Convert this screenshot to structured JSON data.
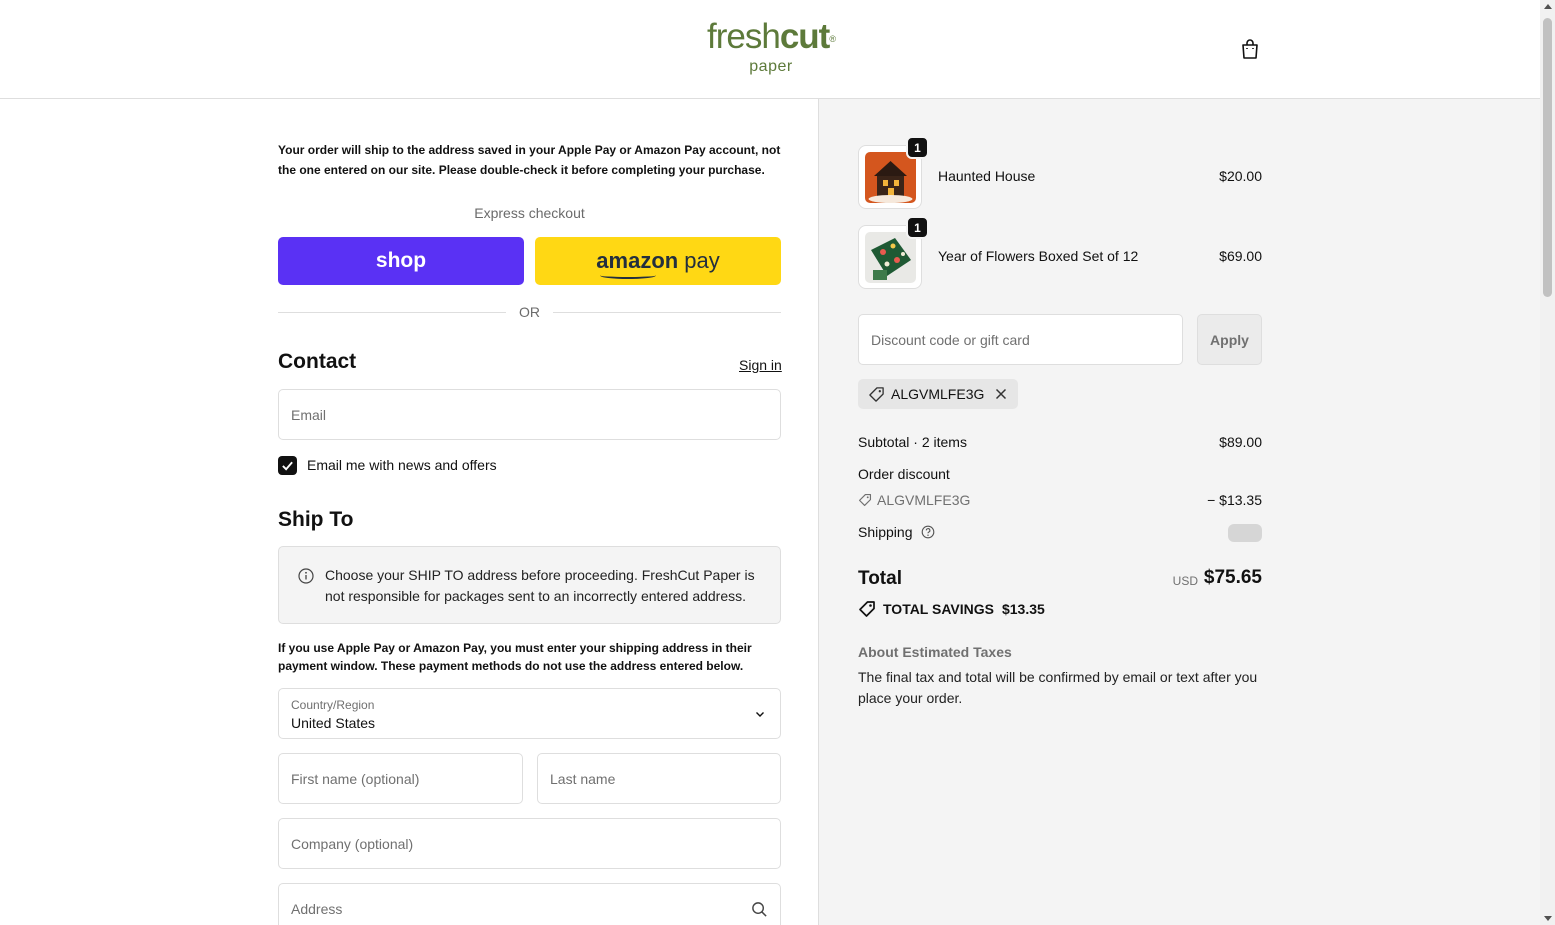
{
  "header": {
    "logo_line1_light": "fresh",
    "logo_line1_bold": "cut",
    "logo_mark": "®",
    "logo_line2": "paper",
    "cart_icon": "shopping-bag-icon",
    "brand_color": "#5d7a3a"
  },
  "checkout": {
    "notice_top": "Your order will ship to the address saved in your Apple Pay or Amazon Pay account, not the one entered on our site. Please double-check it before completing your purchase.",
    "express_label": "Express checkout",
    "shop_pay_label": "shop",
    "amazon_pay_brand": "amazon",
    "amazon_pay_suffix": "pay",
    "or_label": "OR",
    "contact": {
      "heading": "Contact",
      "sign_in": "Sign in",
      "email_placeholder": "Email",
      "newsletter_label": "Email me with news and offers",
      "newsletter_checked": true
    },
    "ship_to": {
      "heading": "Ship To",
      "info_text": "Choose your SHIP TO address before proceeding. FreshCut Paper is not responsible for packages sent to an incorrectly entered address.",
      "notice": "If you use Apple Pay or Amazon Pay, you must enter your shipping address in their payment window. These payment methods do not use the address entered below.",
      "country_label": "Country/Region",
      "country_value": "United States",
      "first_name_placeholder": "First name (optional)",
      "last_name_placeholder": "Last name",
      "company_placeholder": "Company (optional)",
      "address_placeholder": "Address"
    }
  },
  "summary": {
    "items": [
      {
        "name": "Haunted House",
        "price": "$20.00",
        "qty": "1"
      },
      {
        "name": "Year of Flowers Boxed Set of 12",
        "price": "$69.00",
        "qty": "1"
      }
    ],
    "discount_placeholder": "Discount code or gift card",
    "apply_label": "Apply",
    "applied_code": "ALGVMLFE3G",
    "subtotal_label": "Subtotal · 2 items",
    "subtotal_value": "$89.00",
    "order_discount_label": "Order discount",
    "discount_code": "ALGVMLFE3G",
    "discount_value": "− $13.35",
    "shipping_label": "Shipping",
    "total_label": "Total",
    "currency": "USD",
    "total_value": "$75.65",
    "savings_label": "TOTAL SAVINGS",
    "savings_value": "$13.35",
    "about_taxes_heading": "About Estimated Taxes",
    "about_taxes_text": "The final tax and total will be confirmed by email or text after you place your order."
  },
  "colors": {
    "shop_pay": "#5a31f4",
    "amazon_pay": "#ffd814",
    "summary_bg": "#f4f4f4"
  }
}
